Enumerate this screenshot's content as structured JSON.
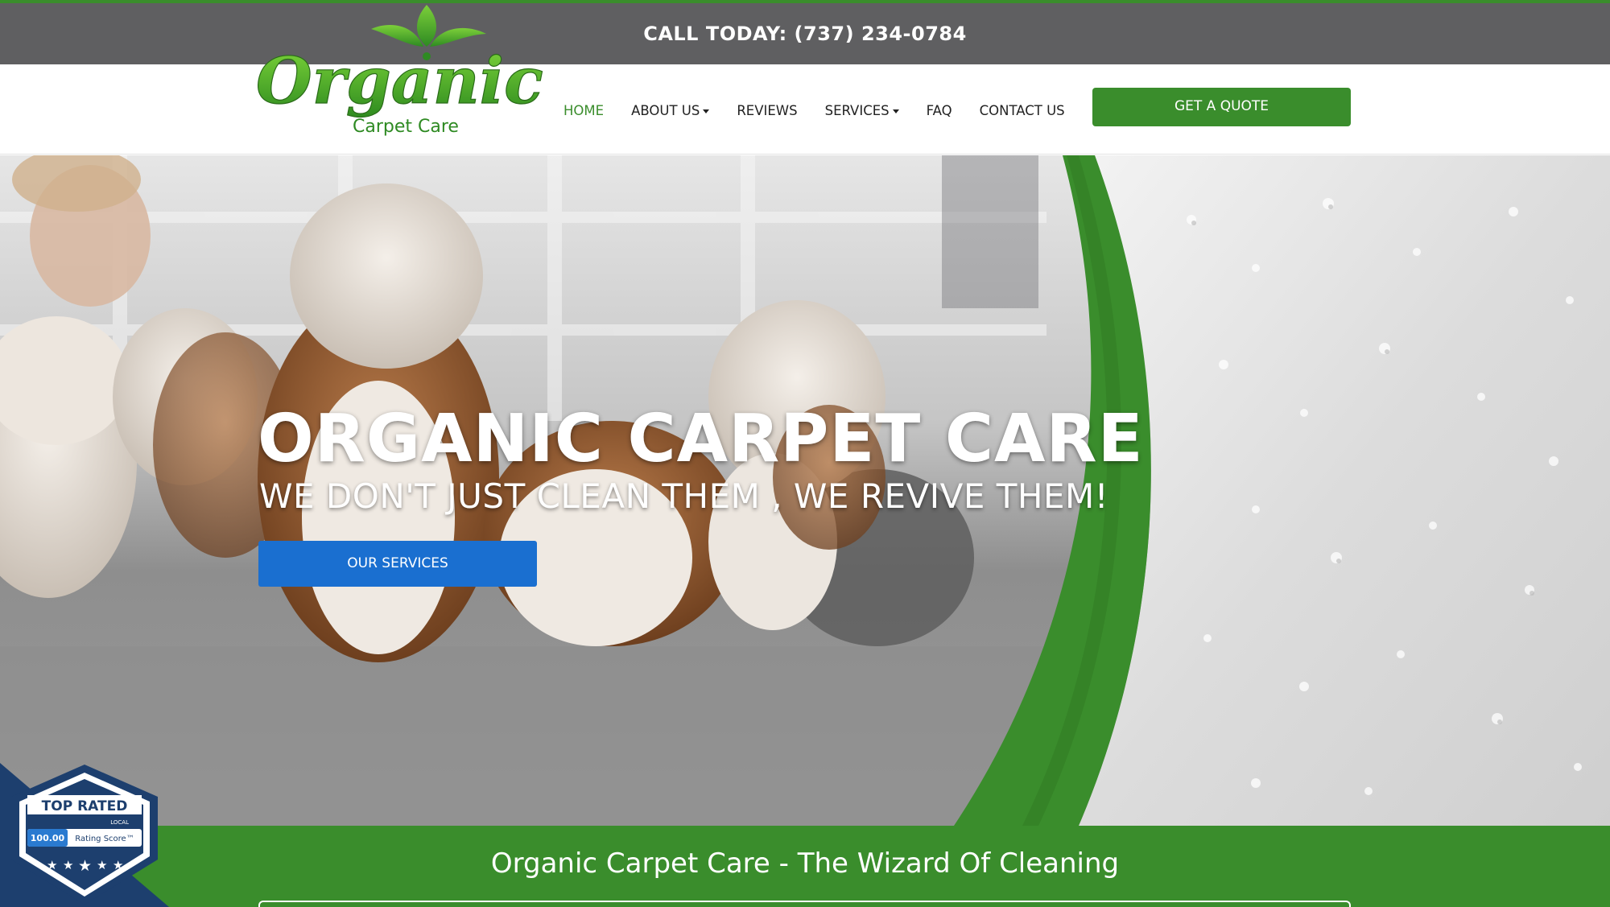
{
  "topbar": {
    "call_text": "CALL TODAY: (737) 234-0784"
  },
  "logo": {
    "word": "Organic",
    "tagline": "Carpet Care"
  },
  "nav": {
    "items": [
      {
        "label": "HOME",
        "active": true,
        "dropdown": false
      },
      {
        "label": "ABOUT US",
        "active": false,
        "dropdown": true
      },
      {
        "label": "REVIEWS",
        "active": false,
        "dropdown": false
      },
      {
        "label": "SERVICES",
        "active": false,
        "dropdown": true
      },
      {
        "label": "FAQ",
        "active": false,
        "dropdown": false
      },
      {
        "label": "CONTACT US",
        "active": false,
        "dropdown": false
      }
    ],
    "quote_button": "GET A QUOTE"
  },
  "hero": {
    "title": "ORGANIC CARPET CARE",
    "subtitle": "WE DON'T JUST CLEAN THEM , WE REVIVE THEM!",
    "button": "OUR SERVICES"
  },
  "bottom": {
    "title": "Organic Carpet Care - The Wizard Of Cleaning"
  },
  "badge": {
    "brand": "TOP RATED",
    "sub": "LOCAL",
    "score": "100.00",
    "score_label": "Rating Score™"
  },
  "colors": {
    "brand_green": "#3a8d2c",
    "topbar_gray": "#5f5f61",
    "button_blue": "#1a6fd0",
    "badge_navy": "#1d3f6e"
  }
}
